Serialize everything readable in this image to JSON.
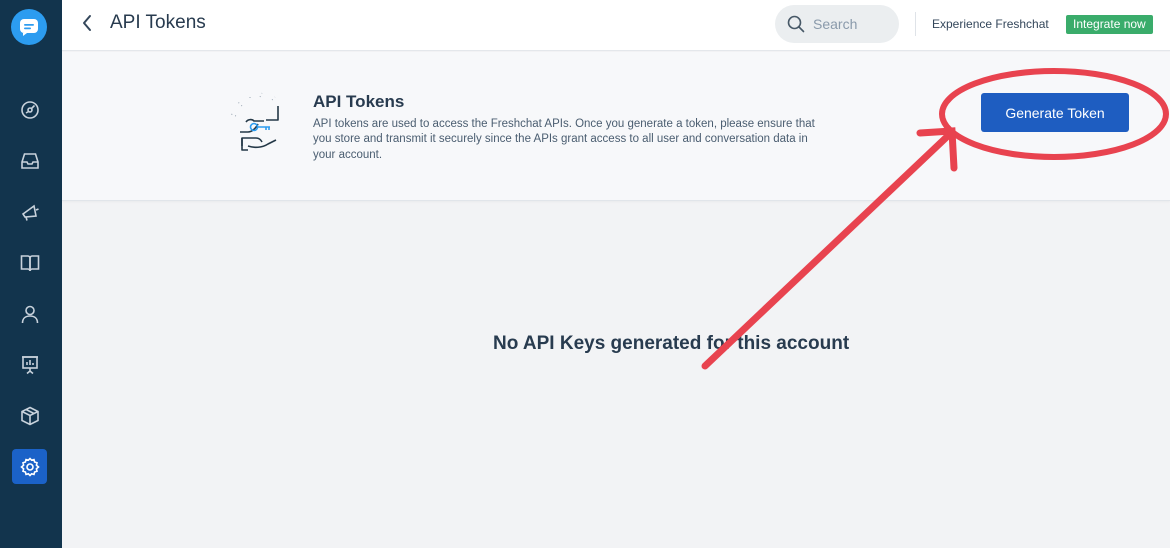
{
  "header": {
    "title": "API Tokens",
    "search_placeholder": "Search",
    "experience_text": "Experience Freshchat",
    "integrate_label": "Integrate now"
  },
  "sidebar": {
    "items": [
      {
        "icon": "dashboard-icon"
      },
      {
        "icon": "inbox-icon"
      },
      {
        "icon": "campaigns-icon"
      },
      {
        "icon": "knowledge-base-icon"
      },
      {
        "icon": "contacts-icon"
      },
      {
        "icon": "reports-icon"
      },
      {
        "icon": "integrations-icon"
      },
      {
        "icon": "settings-icon",
        "active": true
      }
    ]
  },
  "info": {
    "title": "API Tokens",
    "description": "API tokens are used to access the Freshchat APIs. Once you generate a token, please ensure that you store and transmit it securely since the APIs grant access to all user and conversation data in your account.",
    "button_label": "Generate Token"
  },
  "main": {
    "empty_message": "No API Keys generated for this account"
  },
  "colors": {
    "sidebar_bg": "#12344d",
    "primary": "#1e5dc1",
    "success": "#3aac6b",
    "annotation": "#e8434f"
  }
}
